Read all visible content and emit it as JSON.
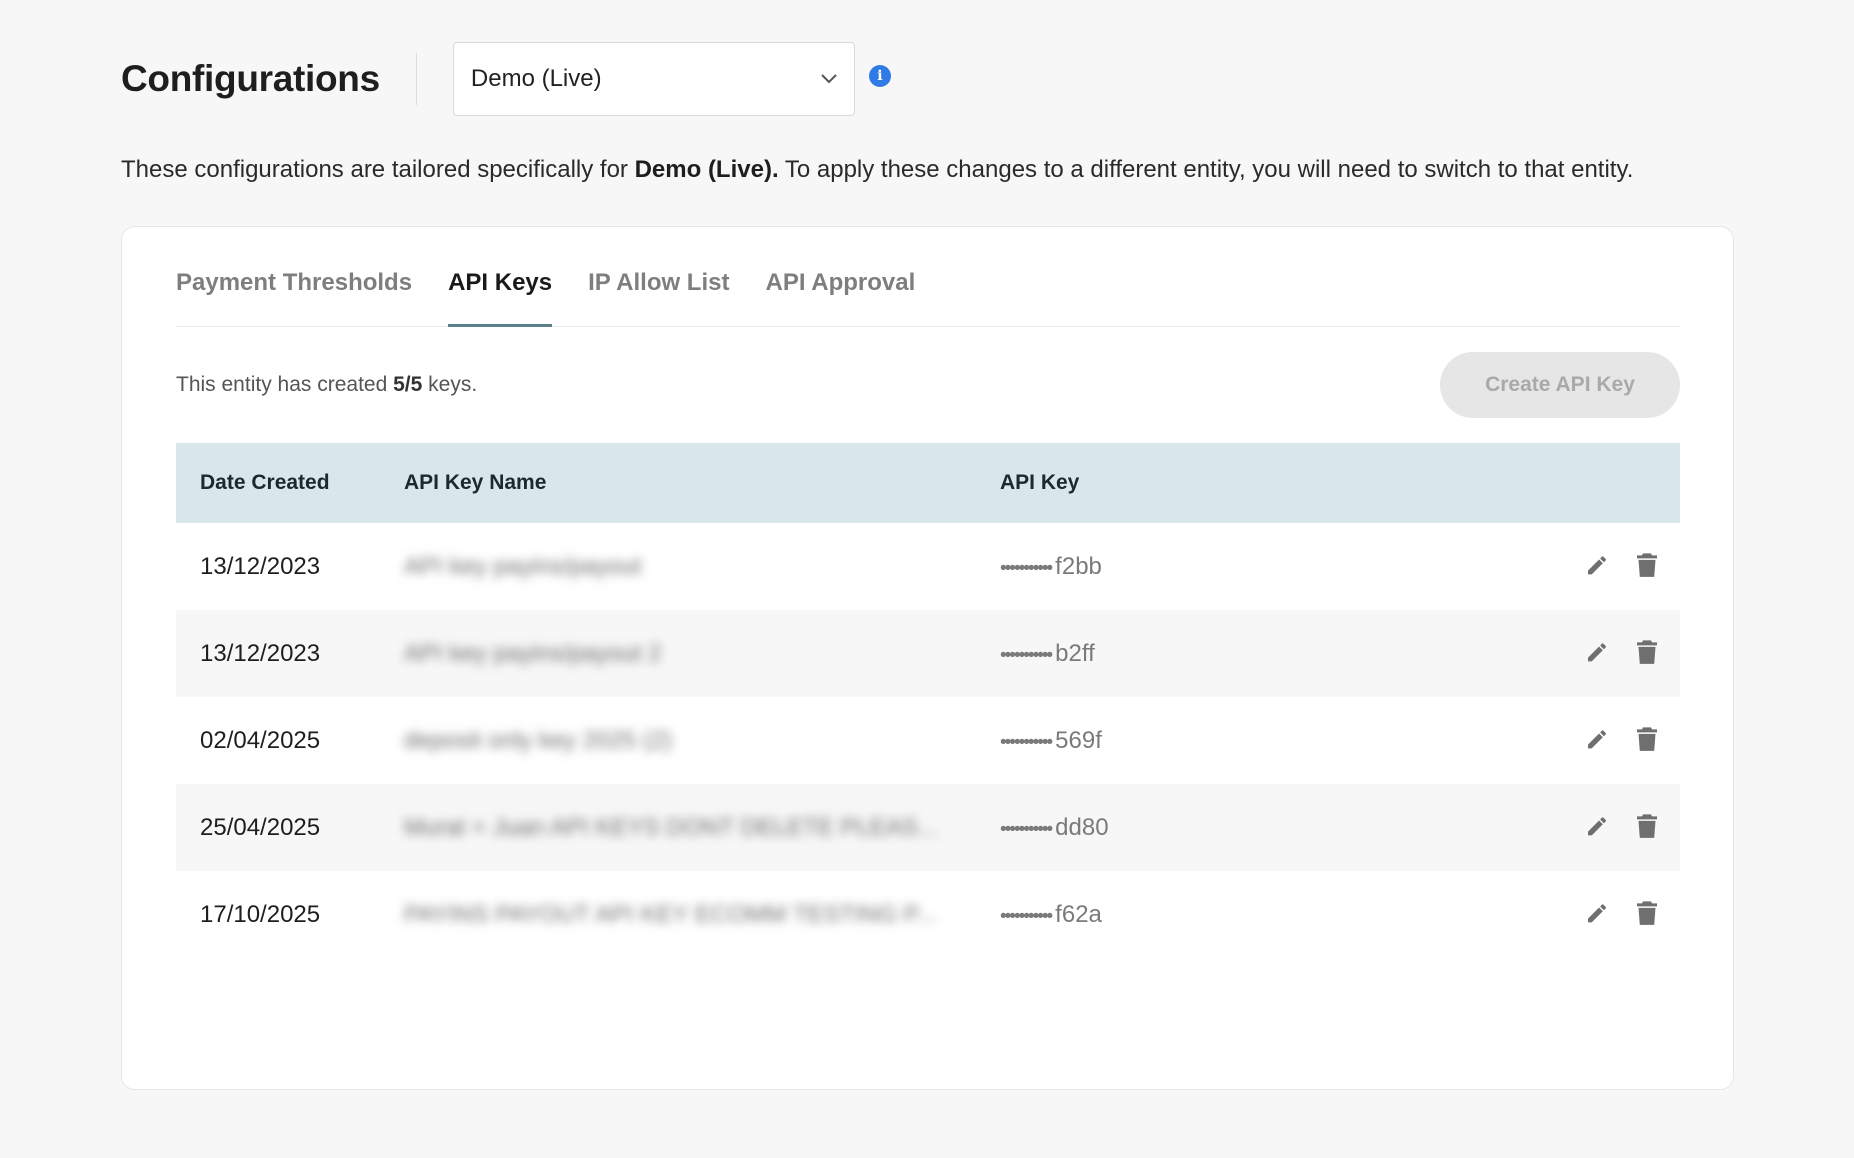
{
  "header": {
    "title": "Configurations",
    "entity_select": {
      "selected": "Demo (Live)"
    },
    "info_icon": "info-icon"
  },
  "description": {
    "prefix": "These configurations are tailored specifically for ",
    "entity": "Demo (Live).",
    "suffix": " To apply these changes to a different entity, you will need to switch to that entity."
  },
  "tabs": [
    {
      "label": "Payment Thresholds",
      "active": false
    },
    {
      "label": "API Keys",
      "active": true
    },
    {
      "label": "IP Allow List",
      "active": false
    },
    {
      "label": "API Approval",
      "active": false
    }
  ],
  "keys_summary": {
    "prefix": "This entity has created ",
    "count": "5/5",
    "suffix": " keys."
  },
  "create_button": {
    "label": "Create API Key",
    "disabled": true
  },
  "table": {
    "columns": [
      "Date Created",
      "API Key Name",
      "API Key"
    ],
    "rows": [
      {
        "date": "13/12/2023",
        "name": "API key payins/payout",
        "key_mask": "•••••••••••",
        "key_suffix": "f2bb"
      },
      {
        "date": "13/12/2023",
        "name": "API key payins/payout 2",
        "key_mask": "•••••••••••",
        "key_suffix": "b2ff"
      },
      {
        "date": "02/04/2025",
        "name": "deposit only key 2025 (2)",
        "key_mask": "•••••••••••",
        "key_suffix": "569f"
      },
      {
        "date": "25/04/2025",
        "name": "Murat + Juan API KEYS DONT DELETE PLEAS...",
        "key_mask": "•••••••••••",
        "key_suffix": "dd80"
      },
      {
        "date": "17/10/2025",
        "name": "PAYINS PAYOUT API KEY ECOMM TESTING P...",
        "key_mask": "•••••••••••",
        "key_suffix": "f62a"
      }
    ],
    "row_actions": [
      "pencil-icon",
      "trash-icon"
    ]
  },
  "colors": {
    "accent_blue": "#2f7ae5",
    "table_header_bg": "#d8e7ec",
    "tab_indicator": "#5c7f8c",
    "icon_gray": "#6f6f6f"
  }
}
